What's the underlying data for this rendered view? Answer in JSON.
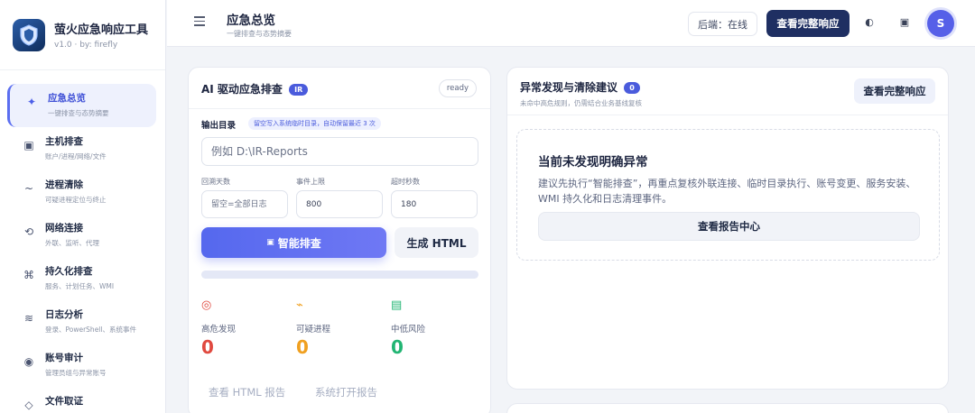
{
  "brand": {
    "title": "萤火应急响应工具",
    "version": "v1.0 · by: firefly",
    "logo_icon": "shield-logo-icon"
  },
  "nav": [
    {
      "label": "应急总览",
      "sub": "一键排查与态势摘要",
      "icon": "✦",
      "icon_name": "sparkle-icon",
      "active": true
    },
    {
      "label": "主机排查",
      "sub": "账户/进程/网络/文件",
      "icon": "▣",
      "icon_name": "host-icon"
    },
    {
      "label": "进程清除",
      "sub": "可疑进程定位与终止",
      "icon": "~",
      "icon_name": "wave-icon"
    },
    {
      "label": "网络连接",
      "sub": "外联、监听、代理",
      "icon": "⟲",
      "icon_name": "refresh-icon"
    },
    {
      "label": "持久化排查",
      "sub": "服务、计划任务、WMI",
      "icon": "⌘",
      "icon_name": "command-icon"
    },
    {
      "label": "日志分析",
      "sub": "登录、PowerShell、系统事件",
      "icon": "≋",
      "icon_name": "log-icon"
    },
    {
      "label": "账号审计",
      "sub": "管理员组与异常账号",
      "icon": "◉",
      "icon_name": "account-icon"
    },
    {
      "label": "文件取证",
      "sub": "",
      "icon": "◇",
      "icon_name": "file-icon"
    }
  ],
  "header": {
    "title": "应急总览",
    "subtitle": "一键排查与态势摘要",
    "backend_status": "后端：在线",
    "view_response_label": "查看完整响应",
    "theme_icon": "◐",
    "window_icon": "▣",
    "avatar_letter": "S"
  },
  "scan_card": {
    "title": "AI 驱动应急排查",
    "badge": "IR",
    "status": "ready",
    "output_label": "输出目录",
    "output_hint": "留空写入系统临时目录，自动保留最近 3 次",
    "output_placeholder": "例如 D:\\IR-Reports",
    "fields": [
      {
        "label": "回溯天数",
        "placeholder": "留空=全部日志",
        "value": ""
      },
      {
        "label": "事件上限",
        "placeholder": "",
        "value": "800"
      },
      {
        "label": "超时秒数",
        "placeholder": "",
        "value": "180"
      }
    ],
    "primary_button": "智能排查",
    "primary_icon": "▣",
    "html_button": "生成 HTML",
    "progress": 0,
    "stats": [
      {
        "icon": "◎",
        "icon_name": "target-icon",
        "label": "高危发现",
        "value": "0",
        "color": "#e0493f"
      },
      {
        "icon": "⌁",
        "icon_name": "bolt-icon",
        "label": "可疑进程",
        "value": "0",
        "color": "#f0a020"
      },
      {
        "icon": "▤",
        "icon_name": "list-icon",
        "label": "中低风险",
        "value": "0",
        "color": "#22b573"
      }
    ],
    "view_html_report": "查看 HTML 报告",
    "open_report": "系统打开报告"
  },
  "anomaly_card": {
    "title": "异常发现与清除建议",
    "badge": "0",
    "subtitle": "未命中高危规则，仍需结合业务基线复核",
    "button": "查看完整响应",
    "empty_title": "当前未发现明确异常",
    "empty_text": "建议先执行“智能排查”，再重点复核外联连接、临时目录执行、账号变更、服务安装、WMI 持久化和日志清理事件。",
    "report_center": "查看报告中心"
  }
}
